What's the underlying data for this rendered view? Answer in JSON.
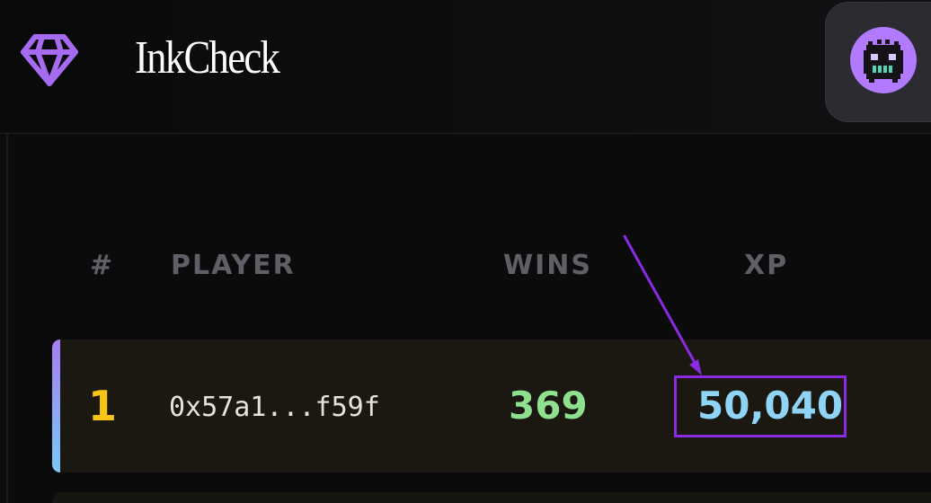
{
  "header": {
    "app_title": "InkCheck",
    "logo_icon": "diamond-icon",
    "avatar_icon": "pixel-monster-icon"
  },
  "leaderboard": {
    "columns": [
      "#",
      "PLAYER",
      "WINS",
      "XP"
    ],
    "rows": [
      {
        "rank": "1",
        "player": "0x57a1...f59f",
        "wins": "369",
        "xp": "50,040"
      }
    ]
  },
  "colors": {
    "background": "#0b0b0c",
    "accent_purple": "#8a2be2",
    "logo_purple": "#a66bf0",
    "rank_gold": "#f7c614",
    "wins_green": "#8ee08e",
    "xp_blue": "#8fd3f5",
    "row_background": "#1a1810",
    "header_muted": "#5f5f66"
  },
  "annotation": {
    "type": "arrow-and-box",
    "target": "xp-value",
    "color": "#8a2be2"
  }
}
